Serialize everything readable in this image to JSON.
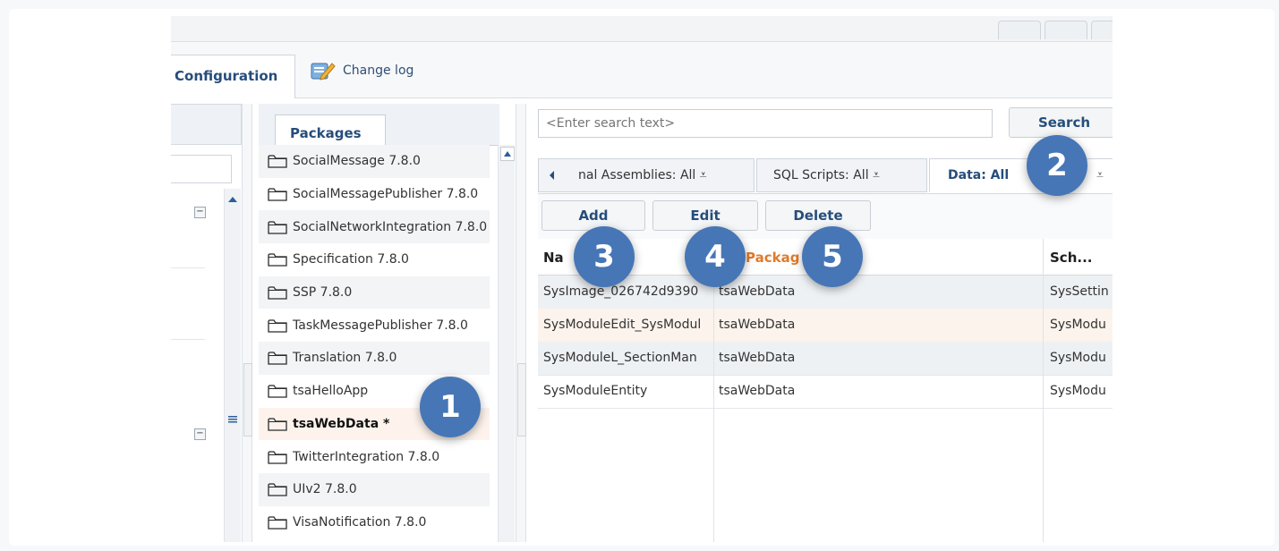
{
  "header": {
    "tab_configuration": "Configuration",
    "tab_changelog": "Change log"
  },
  "packages_panel": {
    "tab_label": "Packages",
    "items": [
      {
        "label": "SocialMessage 7.8.0"
      },
      {
        "label": "SocialMessagePublisher 7.8.0"
      },
      {
        "label": "SocialNetworkIntegration 7.8.0"
      },
      {
        "label": "Specification 7.8.0"
      },
      {
        "label": "SSP 7.8.0"
      },
      {
        "label": "TaskMessagePublisher 7.8.0"
      },
      {
        "label": "Translation 7.8.0"
      },
      {
        "label": "tsaHelloApp"
      },
      {
        "label": "tsaWebData *"
      },
      {
        "label": "TwitterIntegration 7.8.0"
      },
      {
        "label": "UIv2 7.8.0"
      },
      {
        "label": "VisaNotification 7.8.0"
      }
    ]
  },
  "search": {
    "placeholder": "<Enter search text>",
    "button": "Search"
  },
  "type_tabs": [
    {
      "label": "nal Assemblies: All ⩡"
    },
    {
      "label": "SQL Scripts: All ⩡"
    },
    {
      "label": "Data: All"
    }
  ],
  "toolbar": {
    "add": "Add",
    "edit": "Edit",
    "delete": "Delete"
  },
  "grid": {
    "columns": [
      "Na",
      "Packag",
      "Sch..."
    ],
    "rows": [
      {
        "name": "SysImage_026742d9390",
        "package": "tsaWebData",
        "schema": "SysSettin"
      },
      {
        "name": "SysModuleEdit_SysModul",
        "package": "tsaWebData",
        "schema": "SysModu"
      },
      {
        "name": "SysModuleL_SectionMan",
        "package": "tsaWebData",
        "schema": "SysModu"
      },
      {
        "name": "SysModuleEntity",
        "package": "tsaWebData",
        "schema": "SysModu"
      }
    ]
  },
  "callouts": {
    "one": "1",
    "two": "2",
    "three": "3",
    "four": "4",
    "five": "5"
  },
  "colors": {
    "accent_text": "#264d7a",
    "badge": "#4676b6",
    "selected_row": "#fdf3ec",
    "package_header": "#e07a2a"
  }
}
